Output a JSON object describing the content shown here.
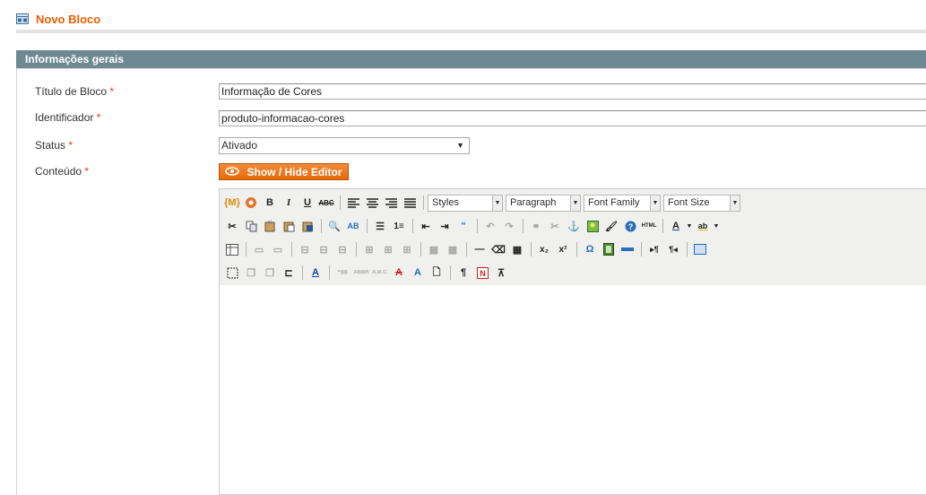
{
  "page": {
    "title": "Novo Bloco"
  },
  "fieldset": {
    "legend": "Informações gerais"
  },
  "form": {
    "title_label": "Título de Bloco",
    "title_value": "Informação de Cores",
    "identifier_label": "Identificador",
    "identifier_value": "produto-informacao-cores",
    "status_label": "Status",
    "status_value": "Ativado",
    "content_label": "Conteúdo",
    "required_mark": "*",
    "toggle_editor_label": "Show / Hide Editor"
  },
  "editor": {
    "styles_label": "Styles",
    "format_label": "Paragraph",
    "font_family_label": "Font Family",
    "font_size_label": "Font Size"
  },
  "colors": {
    "accent": "#eb5e00",
    "header_bar": "#6f8992",
    "button": "#f28b3a"
  }
}
